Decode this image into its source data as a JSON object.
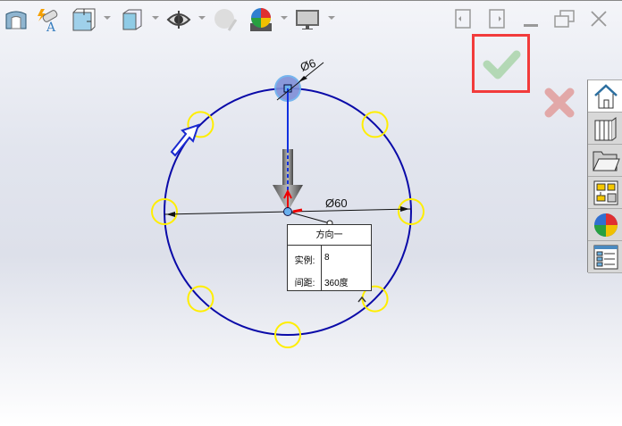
{
  "toolbar": {
    "icons": [
      "section-view-icon",
      "view-orientation-icon",
      "display-style-icon",
      "hide-show-icon",
      "edit-appearance-icon",
      "apply-scene-icon",
      "view-settings-icon",
      "monitor-icon"
    ]
  },
  "window": {
    "icons": [
      "tile-left-icon",
      "tile-right-icon",
      "minimize-icon",
      "restore-icon",
      "close-icon"
    ]
  },
  "confirm": {
    "ok": "confirm-check-icon",
    "cancel": "cancel-x-icon"
  },
  "sidebar": {
    "items": [
      "home-icon",
      "design-library-icon",
      "file-explorer-icon",
      "view-palette-icon",
      "appearances-icon",
      "custom-properties-icon"
    ]
  },
  "dimensions": {
    "hole_diameter": "Ø6",
    "circle_diameter": "Ø60"
  },
  "popup": {
    "title": "方向一",
    "instances_label": "实例:",
    "instances_value": "8",
    "spacing_label": "间距:",
    "spacing_value": "360度"
  },
  "colors": {
    "circle": "#0a0aa8",
    "marker": "#ffee00",
    "accent": "#f23b3b"
  }
}
